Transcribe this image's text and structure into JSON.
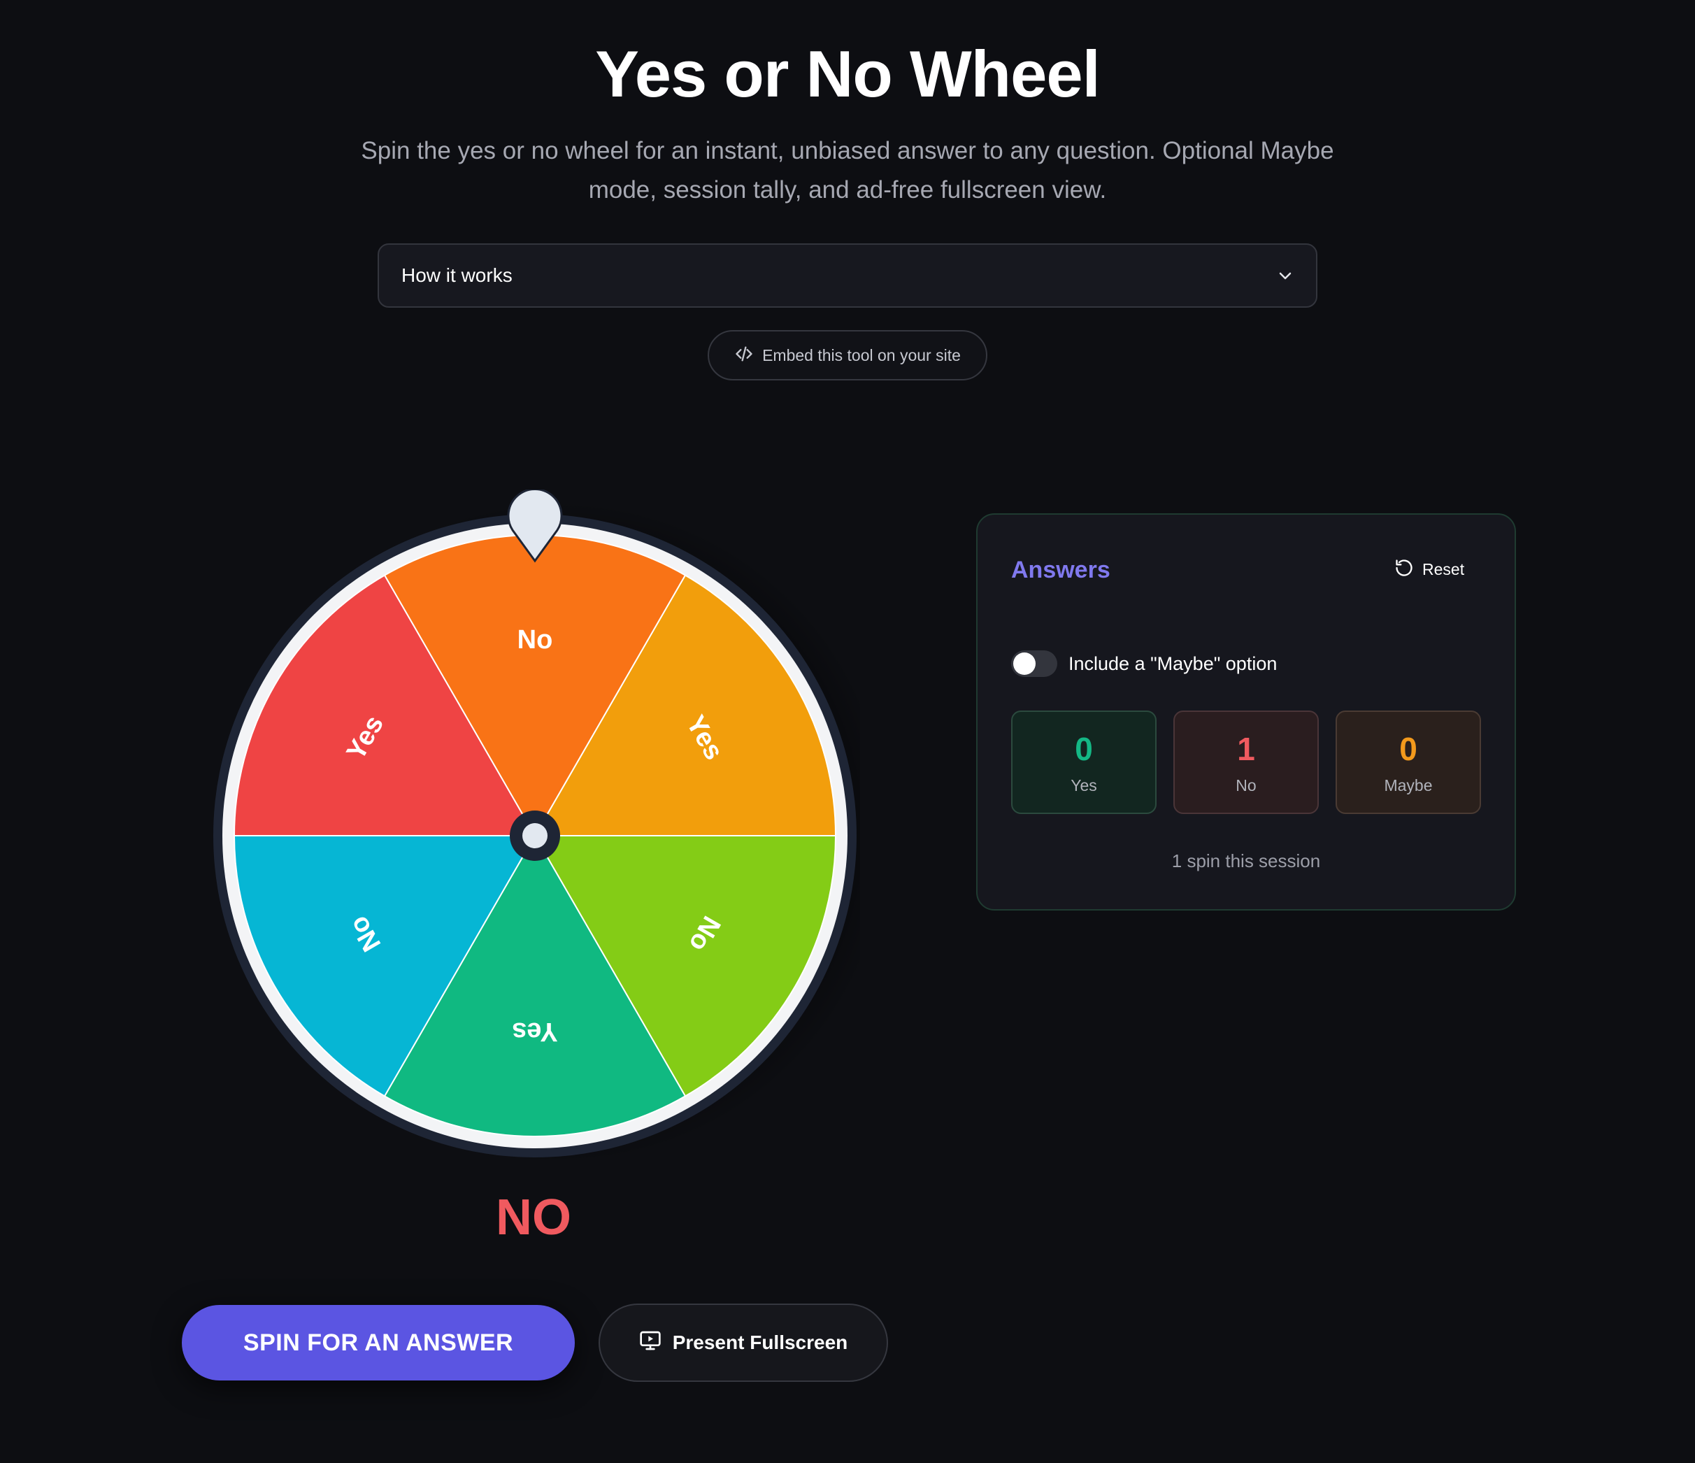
{
  "header": {
    "title": "Yes or No Wheel",
    "subtitle": "Spin the yes or no wheel for an instant, unbiased answer to any question. Optional Maybe mode, session tally, and ad-free fullscreen view."
  },
  "how_it_works": {
    "label": "How it works",
    "icon": "chevron-down-icon"
  },
  "embed": {
    "label": "Embed this tool on your site",
    "icon": "code-icon"
  },
  "wheel": {
    "segments": [
      {
        "label": "No",
        "color": "#f97316"
      },
      {
        "label": "Yes",
        "color": "#f29e0c"
      },
      {
        "label": "No",
        "color": "#84cc16"
      },
      {
        "label": "Yes",
        "color": "#10b981"
      },
      {
        "label": "No",
        "color": "#06b6d4"
      },
      {
        "label": "Yes",
        "color": "#ef4444"
      }
    ],
    "rim_color": "#f3f4f6",
    "outer_ring_color": "#1e2535",
    "pointer_color": "#e2e8f0"
  },
  "result": {
    "text": "NO",
    "color": "#f05a5f"
  },
  "buttons": {
    "spin_label": "SPIN FOR AN ANSWER",
    "present_label": "Present Fullscreen",
    "present_icon": "monitor-play-icon",
    "accent_color": "#5b55e2"
  },
  "answers_panel": {
    "title": "Answers",
    "reset_label": "Reset",
    "reset_icon": "refresh-icon",
    "maybe_toggle_label": "Include a \"Maybe\" option",
    "maybe_toggle_on": false,
    "tally": {
      "yes": {
        "count": "0",
        "label": "Yes",
        "color": "#14b885"
      },
      "no": {
        "count": "1",
        "label": "No",
        "color": "#f05a5f"
      },
      "maybe": {
        "count": "0",
        "label": "Maybe",
        "color": "#f39a1c"
      }
    },
    "session_text": "1 spin this session"
  }
}
